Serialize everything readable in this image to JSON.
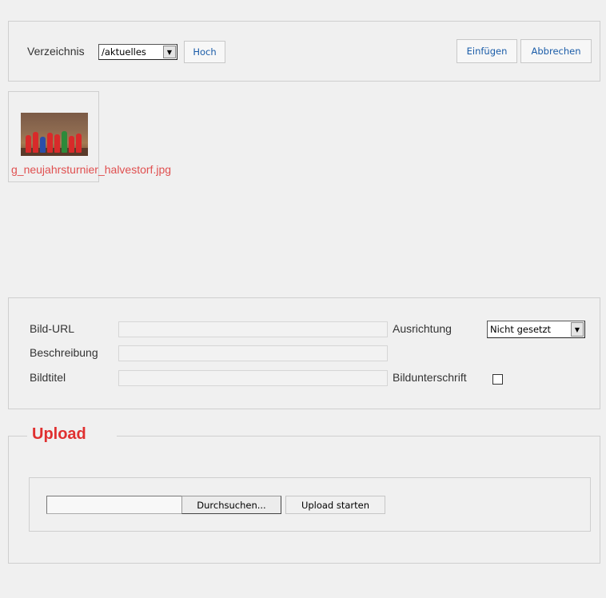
{
  "toolbar": {
    "directory_label": "Verzeichnis",
    "directory_value": "/aktuelles",
    "up_button": "Hoch",
    "insert_button": "Einfügen",
    "cancel_button": "Abbrechen"
  },
  "files": [
    {
      "name": "g_neujahrsturnier_halvestorf.jpg"
    }
  ],
  "properties": {
    "url_label": "Bild-URL",
    "url_value": "",
    "description_label": "Beschreibung",
    "description_value": "",
    "title_label": "Bildtitel",
    "title_value": "",
    "alignment_label": "Ausrichtung",
    "alignment_value": "Nicht gesetzt",
    "caption_label": "Bildunterschrift",
    "caption_checked": false
  },
  "upload": {
    "legend": "Upload",
    "browse_button": "Durchsuchen...",
    "start_button": "Upload starten"
  },
  "colors": {
    "link_blue": "#1a5ca8",
    "filename_red": "#e05050",
    "legend_red": "#e03030"
  }
}
